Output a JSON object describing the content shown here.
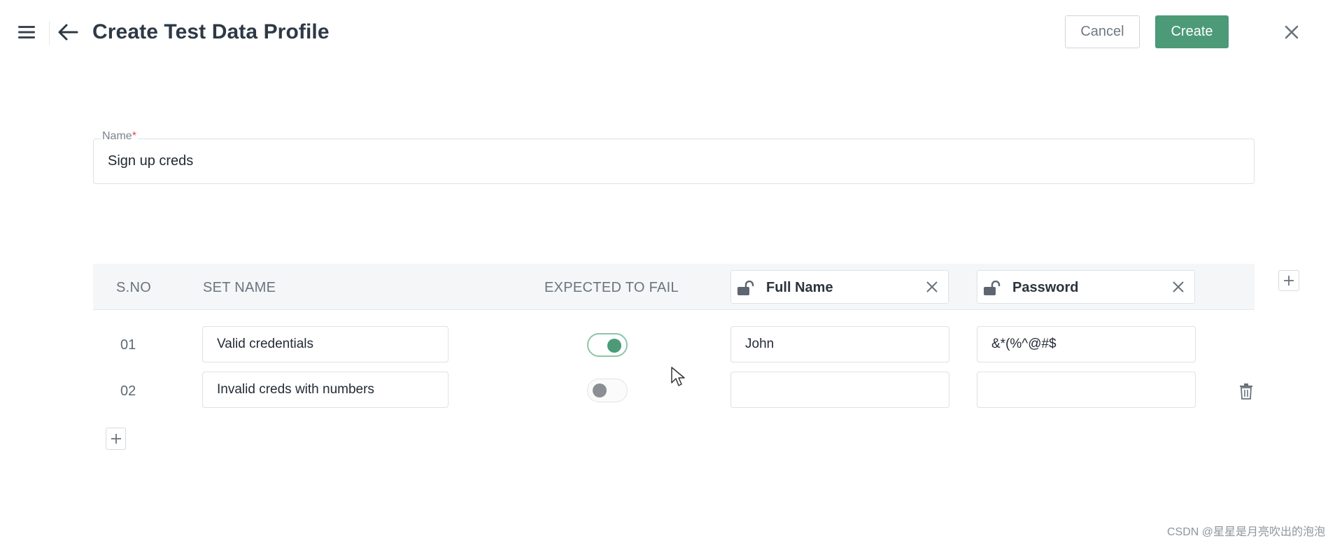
{
  "header": {
    "title": "Create Test Data Profile",
    "cancel_label": "Cancel",
    "create_label": "Create",
    "accent_color": "#4c9a78"
  },
  "form": {
    "name_label": "Name",
    "required_mark": "*",
    "name_value": "Sign up creds"
  },
  "table": {
    "columns": {
      "sno": "S.NO",
      "set_name": "SET NAME",
      "expected_to_fail": "EXPECTED TO FAIL"
    },
    "data_columns": [
      {
        "label": "Full Name",
        "icon": "unlock-icon"
      },
      {
        "label": "Password",
        "icon": "unlock-icon"
      }
    ],
    "rows": [
      {
        "sno": "01",
        "set_name": "Valid credentials",
        "expected_to_fail": true,
        "full_name": "John",
        "password": "&*(%^@#$"
      },
      {
        "sno": "02",
        "set_name": "Invalid creds with numbers",
        "expected_to_fail": false,
        "full_name": "",
        "password": ""
      }
    ]
  },
  "watermark": "CSDN @星星是月亮吹出的泡泡"
}
